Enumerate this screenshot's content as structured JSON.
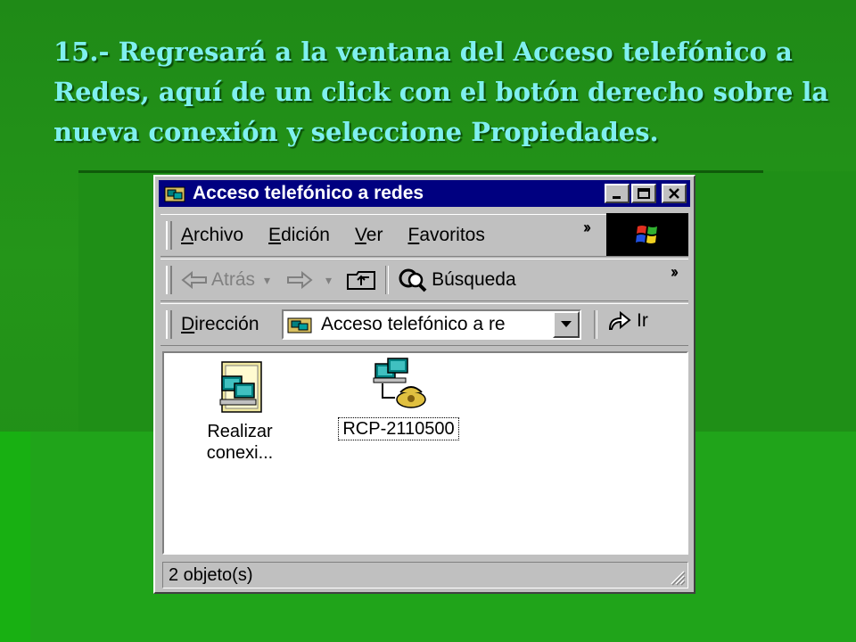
{
  "slide": {
    "title": "15.- Regresará a la ventana del Acceso telefónico a Redes, aquí de un click con el botón derecho sobre la nueva conexión y seleccione Propiedades."
  },
  "window": {
    "title": "Acceso telefónico a redes",
    "menu": [
      {
        "accel": "A",
        "rest": "rchivo"
      },
      {
        "accel": "E",
        "rest": "dición"
      },
      {
        "accel": "V",
        "rest": "er"
      },
      {
        "accel": "F",
        "rest": "avoritos"
      }
    ],
    "toolbar": {
      "back_label": "Atrás",
      "search_label": "Búsqueda"
    },
    "address": {
      "label_accel": "D",
      "label_rest": "irección",
      "value": "Acceso telefónico a re",
      "go_label": "Ir"
    },
    "items": [
      {
        "line1": "Realizar",
        "line2": "conexi..."
      },
      {
        "line1": "RCP-2110500"
      }
    ],
    "status": "2 objeto(s)"
  },
  "colors": {
    "background": "#2a9a1e",
    "title_text": "#7ff0f0",
    "titlebar": "#000080",
    "window_face": "#c0c0c0"
  }
}
